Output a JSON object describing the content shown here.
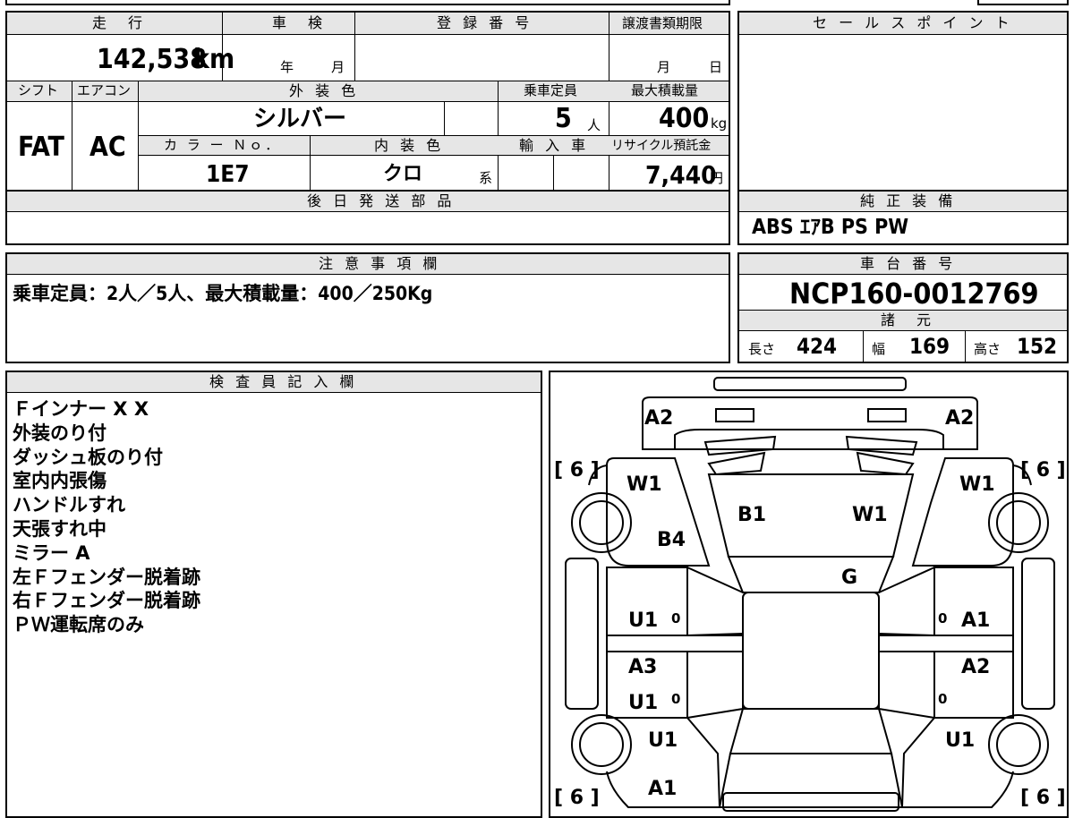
{
  "top": {
    "mileage_header": "走　行",
    "shaken_header": "車　検",
    "reg_header": "登 録 番 号",
    "transfer_header": "譲渡書類期限",
    "sales_header": "セ ー ル ス ポ イ ン ト",
    "mileage_value": "142,538",
    "mileage_unit": "km",
    "year_label": "年",
    "month_label": "月",
    "transfer_month": "月",
    "transfer_day": "日"
  },
  "specs": {
    "shift_header": "シフト",
    "aircon_header": "エアコン",
    "exterior_header": "外 装 色",
    "capacity_header": "乗車定員",
    "maxload_header": "最大積載量",
    "shift_value": "FAT",
    "aircon_value": "AC",
    "exterior_value": "シルバー",
    "capacity_value": "5",
    "capacity_unit": "人",
    "maxload_value": "400",
    "maxload_unit": "kg",
    "colorno_header": "カ ラ ー Ｎｏ．",
    "interior_header": "内 装 色",
    "import_header": "輸 入 車",
    "recycle_header": "リサイクル預託金",
    "colorno_value": "1E7",
    "interior_value": "クロ",
    "interior_suffix": "系",
    "recycle_value": "7,440",
    "recycle_unit": "円"
  },
  "later_parts_header": "後 日 発 送 部 品",
  "genuine": {
    "header": "純 正 装 備",
    "value": "ABS  ｴｱB  PS  PW"
  },
  "notes": {
    "header": "注 意 事 項 欄",
    "value": "乗車定員：2人／5人、最大積載量：400／250Kg"
  },
  "chassis": {
    "header": "車 台 番 号",
    "value": "NCP160-0012769",
    "dims_header": "諸　元",
    "length_label": "長さ",
    "length_value": "424",
    "width_label": "幅",
    "width_value": "169",
    "height_label": "高さ",
    "height_value": "152"
  },
  "inspector": {
    "header": "検 査 員 記 入 欄",
    "lines": [
      "Ｆインナー X X",
      "外装のり付",
      "ダッシュ板のり付",
      "室内内張傷",
      "ハンドルすれ",
      "天張すれ中",
      "ミラー A",
      "左Ｆフェンダー脱着跡",
      "右Ｆフェンダー脱着跡",
      "ＰＷ運転席のみ"
    ]
  },
  "diagram": {
    "front_left": "A2",
    "front_right": "A2",
    "tire_fl": "[ 6 ]",
    "tire_fr": "[ 6 ]",
    "tire_rl": "[ 6 ]",
    "tire_rr": "[ 6 ]",
    "fender_left": "W1",
    "fender_right": "W1",
    "hood_left": "B1",
    "hood_right": "W1",
    "pillar_left": "B4",
    "windshield": "G",
    "front_door_left": "U1",
    "front_door_right": "A1",
    "rear_door_left_a": "A3",
    "rear_door_left_b": "U1",
    "rear_door_right": "A2",
    "rear_fender_left": "U1",
    "rear_fender_right": "U1",
    "rear_bottom": "A1",
    "zero_1": "0",
    "zero_2": "0",
    "zero_3": "0",
    "zero_4": "0"
  }
}
